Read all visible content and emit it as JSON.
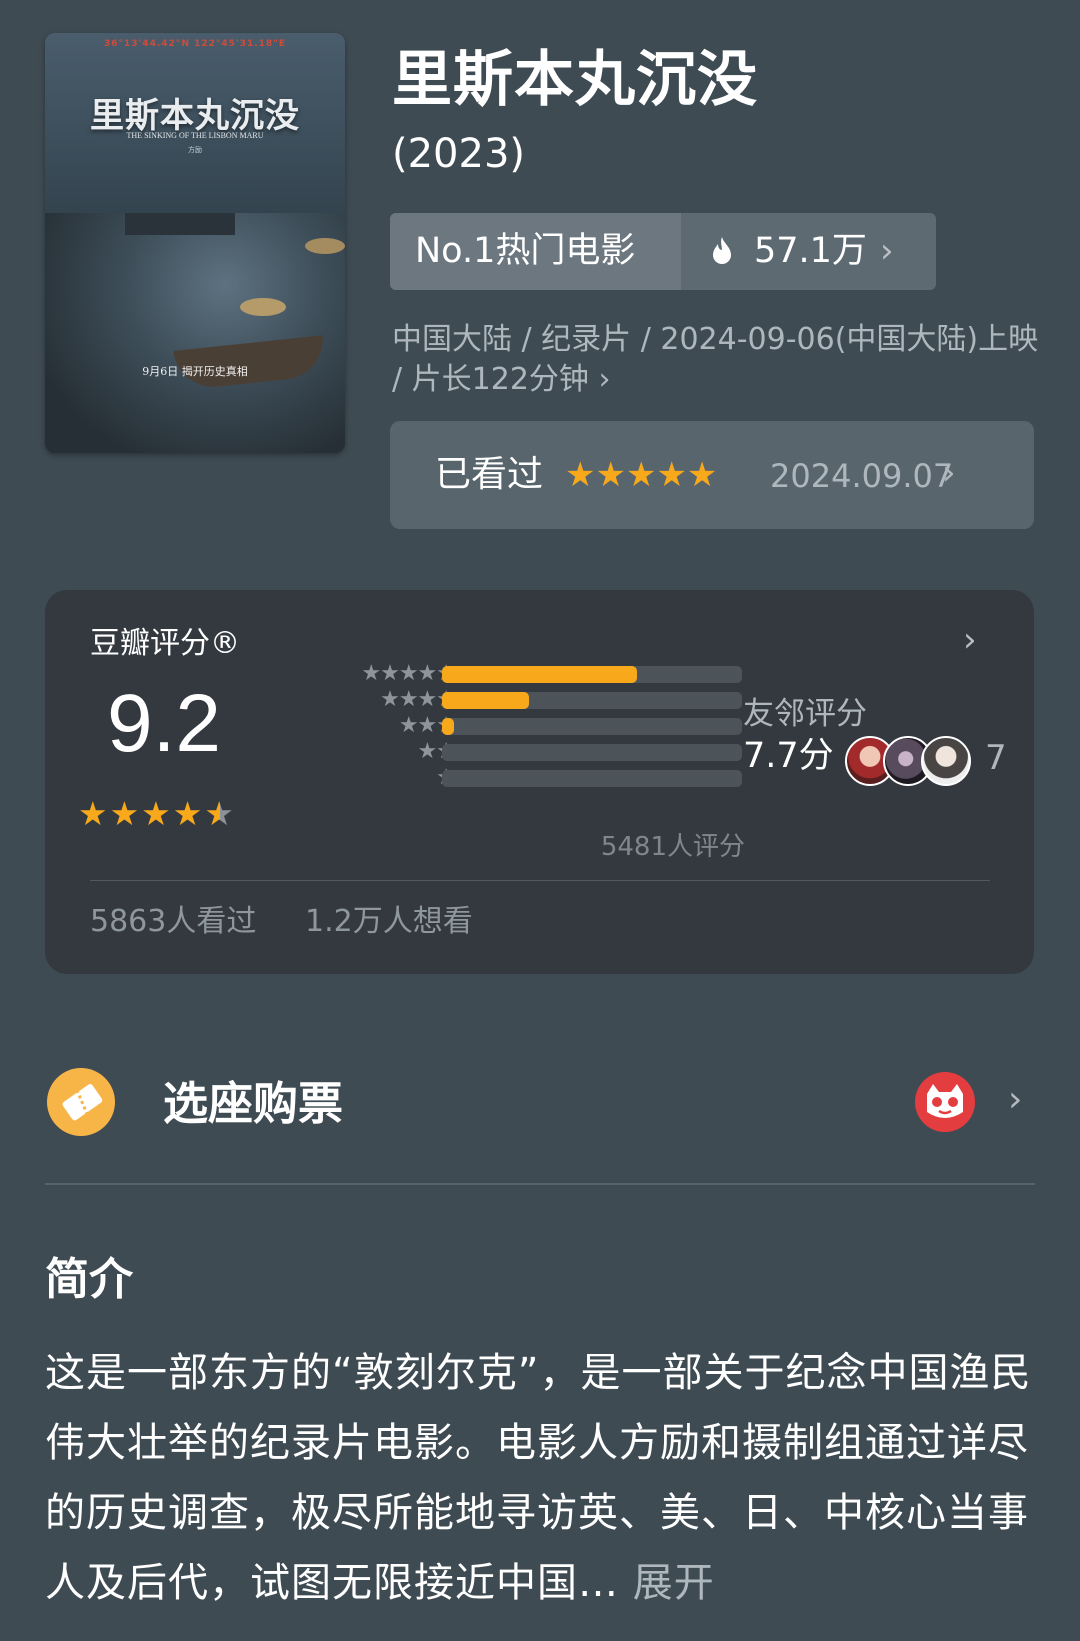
{
  "poster": {
    "coords": "36°13'44.42\"N   122°45'31.18\"E",
    "title": "里斯本丸沉没",
    "subtitle": "THE SINKING OF THE LISBON MARU",
    "director": "方励",
    "tagline": "9月6日  揭开历史真相"
  },
  "movie": {
    "title": "里斯本丸沉没",
    "year": "(2023)"
  },
  "hot": {
    "label": "No.1热门电影",
    "count": "57.1万",
    "icon": "fire-icon"
  },
  "meta": {
    "line": "中国大陆 / 纪录片 / 2024-09-06(中国大陆)上映 / 片长122分钟",
    "arrow": "›"
  },
  "watched": {
    "label": "已看过",
    "stars": "★★★★★",
    "rating": 5,
    "date": "2024.09.07",
    "arrow": "›"
  },
  "rating": {
    "title": "豆瓣评分®",
    "score": "9.2",
    "stars_filled": "★★★★",
    "stars_half": "★",
    "breakdown": [
      {
        "stars": "★★★★★",
        "fraction": 0.65
      },
      {
        "stars": "★★★★",
        "fraction": 0.29
      },
      {
        "stars": "★★★",
        "fraction": 0.04
      },
      {
        "stars": "★★",
        "fraction": 0.0
      },
      {
        "stars": "★",
        "fraction": 0.0
      }
    ],
    "count": "5481人评分",
    "friend_label": "友邻评分",
    "friend_score": "7.7分",
    "friend_count": "7",
    "seen": "5863人看过",
    "want": "1.2万人想看",
    "arrow": "›"
  },
  "ticket": {
    "label": "选座购票",
    "icon": "ticket-icon",
    "partner_icon": "maoyan-cat-icon",
    "arrow": "›"
  },
  "intro": {
    "title": "简介",
    "text": "这是一部东方的“敦刻尔克”，是一部关于纪念中国渔民伟大壮举的纪录片电影。电影人方励和摄制组通过详尽的历史调查，极尽所能地寻访英、美、日、中核心当事人及后代，试图无限接近中国…",
    "expand": " 展开"
  },
  "colors": {
    "background": "#3f4b53",
    "accent_star": "#f7a81b",
    "card": "#33393f"
  }
}
